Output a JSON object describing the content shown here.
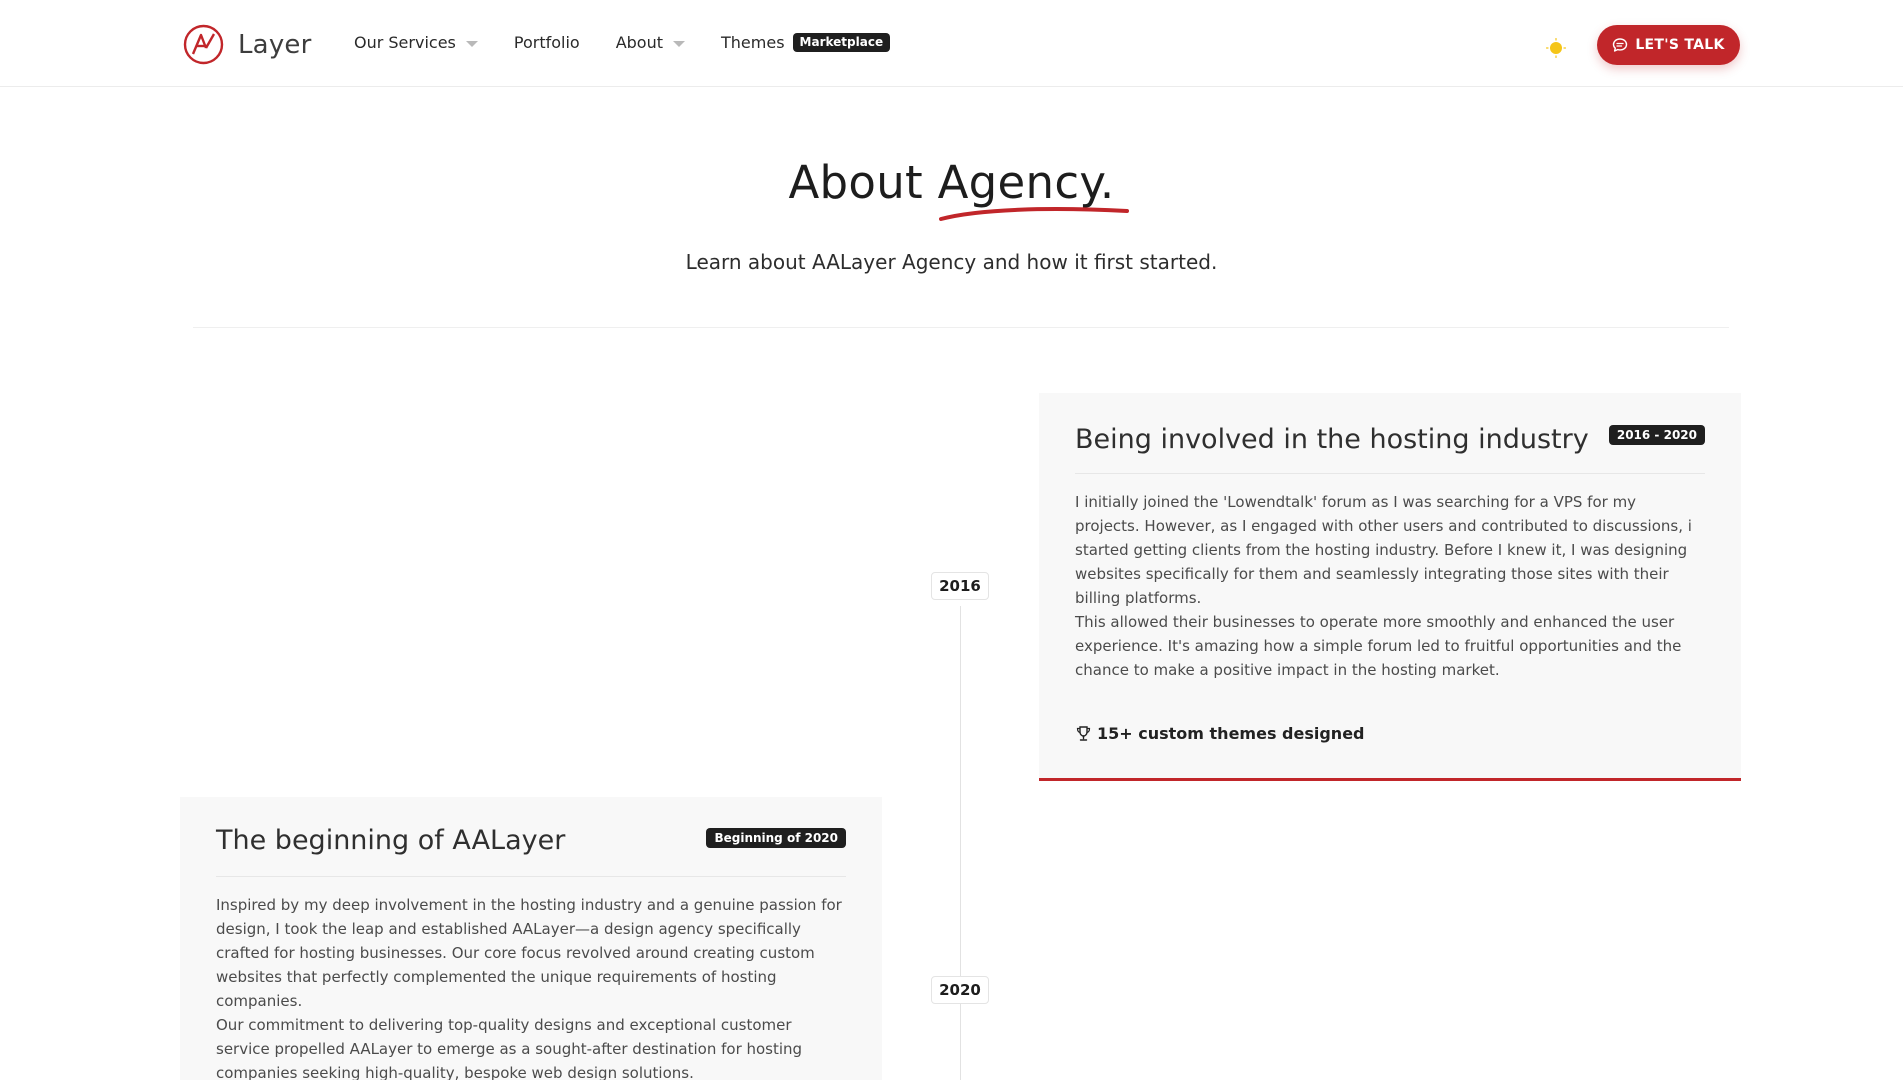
{
  "header": {
    "brand": "Layer",
    "nav": [
      {
        "label": "Our Services",
        "dropdown": true
      },
      {
        "label": "Portfolio",
        "dropdown": false
      },
      {
        "label": "About",
        "dropdown": true
      },
      {
        "label": "Themes",
        "badge": "Marketplace"
      }
    ],
    "theme_icon": "sun-icon",
    "cta_label": "LET'S TALK",
    "cta_icon": "chat-bubble-icon"
  },
  "hero": {
    "title": "About Agency.",
    "subtitle": "Learn about AALayer Agency and how it first started."
  },
  "timeline": {
    "years": [
      "2016",
      "2020"
    ],
    "entries": [
      {
        "title": "Being involved in the hosting industry",
        "badge": "2016 - 2020",
        "paragraphs": [
          "I initially joined the 'Lowendtalk' forum as I was searching for a VPS for my projects. However, as I engaged with other users and contributed to discussions, i started getting clients from the hosting industry. Before I knew it, I was designing websites specifically for them and seamlessly integrating those sites with their billing platforms.",
          "This allowed their businesses to operate more smoothly and enhanced the user experience. It's amazing how a simple forum led to fruitful opportunities and the chance to make a positive impact in the hosting market."
        ],
        "achievement": "15+ custom themes designed",
        "achievement_icon": "trophy-icon"
      },
      {
        "title": "The beginning of AALayer",
        "badge": "Beginning of 2020",
        "paragraphs": [
          "Inspired by my deep involvement in the hosting industry and a genuine passion for design, I took the leap and established AALayer—a design agency specifically crafted for hosting businesses. Our core focus revolved around creating custom websites that perfectly complemented the unique requirements of hosting companies.",
          "Our commitment to delivering top-quality designs and exceptional customer service propelled AALayer to emerge as a sought-after destination for hosting companies seeking high-quality, bespoke web design solutions."
        ]
      }
    ]
  },
  "colors": {
    "accent": "#c1262a",
    "dark_badge": "#1f1f1f",
    "card_bg": "#f8f8f8",
    "sun": "#f5c518"
  }
}
